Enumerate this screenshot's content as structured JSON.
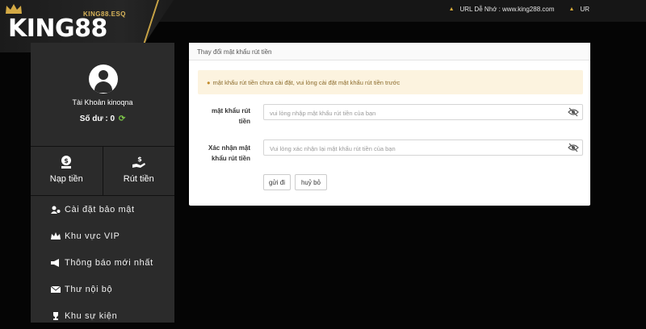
{
  "brand": {
    "logo_text": "KING88",
    "logo_sub": "KING88.ESQ"
  },
  "topbar": {
    "url_label": "URL Dễ Nhớ : www.king288.com",
    "ur_label": "UR"
  },
  "sidebar": {
    "account_label": "Tài Khoản kinoqna",
    "balance_label": "Số dư : 0",
    "actions": [
      {
        "label": "Nạp tiền",
        "icon": "deposit-icon"
      },
      {
        "label": "Rút tiền",
        "icon": "withdraw-icon"
      }
    ],
    "menu": [
      {
        "label": "Cài đặt bảo mật",
        "icon": "user-settings-icon"
      },
      {
        "label": "Khu vực VIP",
        "icon": "crown-icon"
      },
      {
        "label": "Thông báo mới nhất",
        "icon": "megaphone-icon"
      },
      {
        "label": "Thư nội bộ",
        "icon": "mail-icon"
      },
      {
        "label": "Khu sự kiện",
        "icon": "trophy-icon"
      }
    ]
  },
  "panel": {
    "title": "Thay đổi mật khẩu rút tiền",
    "alert": "mật khẩu rút tiền chưa cài đặt, vui lòng cài đặt mật khẩu rút tiền trước",
    "fields": [
      {
        "label_line1": "mật khẩu rút",
        "label_line2": "tiền",
        "placeholder": "vui lòng nhập mật khẩu rút tiền của bạn",
        "value": ""
      },
      {
        "label_line1": "Xác nhận mật",
        "label_line2": "khẩu rút tiền",
        "placeholder": "Vui lòng xác nhận lại mật khẩu rút tiền của bạn",
        "value": ""
      }
    ],
    "submit_label": "gửi đi",
    "cancel_label": "huỷ bỏ"
  },
  "colors": {
    "accent_gold": "#c9a446",
    "background": "#050505",
    "sidebar": "#2b2b2b",
    "alert_bg": "#fcf3df"
  }
}
